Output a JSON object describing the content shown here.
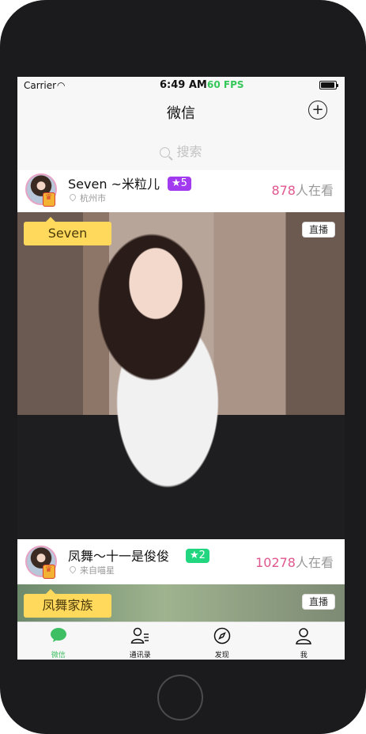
{
  "status_bar": {
    "carrier": "Carrier",
    "time": "6:49 AM",
    "fps": "60 FPS"
  },
  "nav": {
    "title": "微信"
  },
  "search": {
    "placeholder": "搜索"
  },
  "cards": [
    {
      "name": "Seven ~米粒儿",
      "level": "★5",
      "level_color": "#a23bf0",
      "location": "杭州市",
      "viewers_count": "878",
      "viewers_suffix": "人在看",
      "name_tag": "Seven",
      "live_label": "直播"
    },
    {
      "name": "凤舞～十一是俊俊",
      "level": "★2",
      "level_color": "#22d67f",
      "location": "来自喵星",
      "viewers_count": "10278",
      "viewers_suffix": "人在看",
      "name_tag": "凤舞家族",
      "live_label": "直播"
    }
  ],
  "tabs": [
    {
      "label": "微信",
      "icon": "chat-bubble-icon",
      "active": true
    },
    {
      "label": "通讯录",
      "icon": "contacts-icon",
      "active": false
    },
    {
      "label": "发现",
      "icon": "compass-icon",
      "active": false
    },
    {
      "label": "我",
      "icon": "person-icon",
      "active": false
    }
  ],
  "colors": {
    "accent_green": "#3fbf63",
    "viewer_pink": "#e0568e",
    "tag_yellow": "#ffd95c"
  }
}
